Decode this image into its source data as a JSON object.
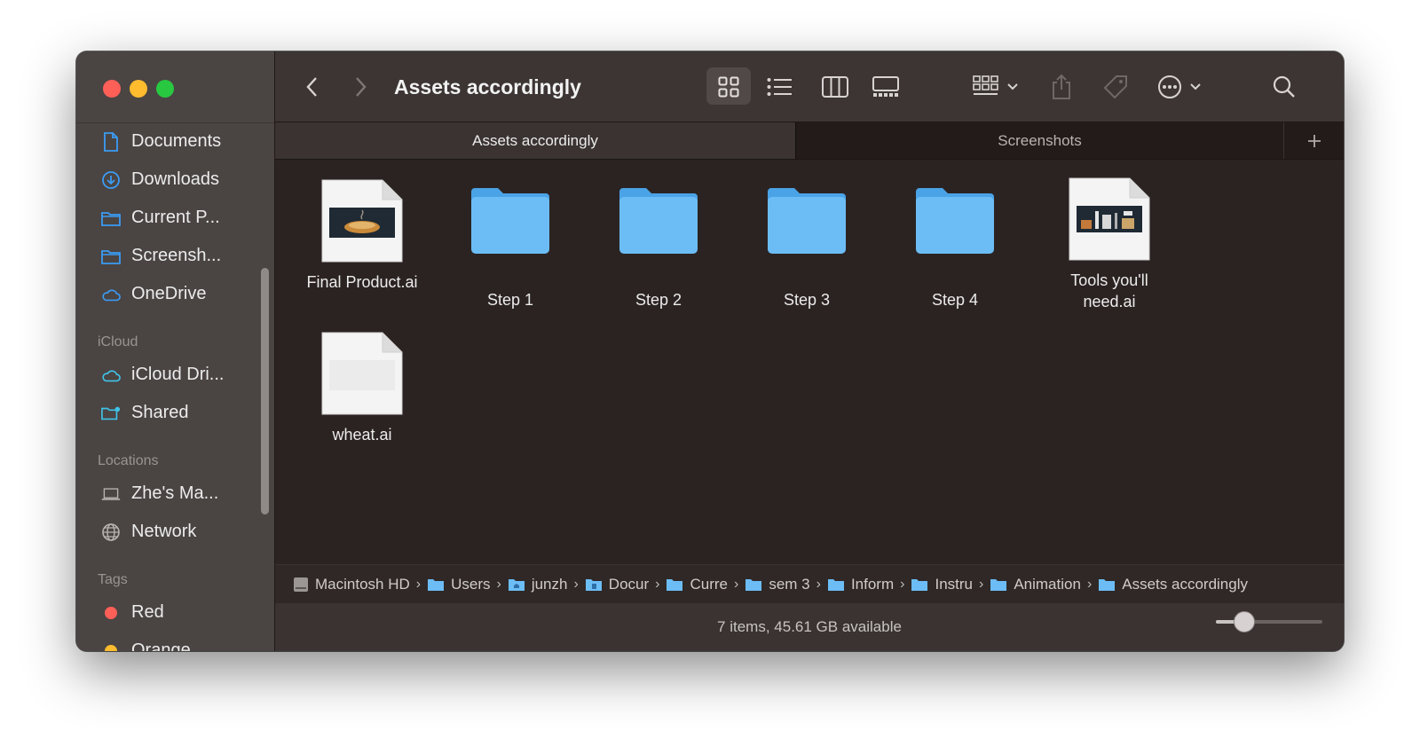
{
  "window": {
    "title": "Assets accordingly"
  },
  "sidebar": {
    "favorites": [
      {
        "label": "Documents",
        "icon": "document-icon"
      },
      {
        "label": "Downloads",
        "icon": "download-icon"
      },
      {
        "label": "Current P...",
        "icon": "folder-icon"
      },
      {
        "label": "Screensh...",
        "icon": "folder-icon"
      },
      {
        "label": "OneDrive",
        "icon": "cloud-icon"
      }
    ],
    "icloud_heading": "iCloud",
    "icloud": [
      {
        "label": "iCloud Dri...",
        "icon": "cloud-icon"
      },
      {
        "label": "Shared",
        "icon": "shared-folder-icon"
      }
    ],
    "locations_heading": "Locations",
    "locations": [
      {
        "label": "Zhe's Ma...",
        "icon": "laptop-icon"
      },
      {
        "label": "Network",
        "icon": "globe-icon"
      }
    ],
    "tags_heading": "Tags",
    "tags": [
      {
        "label": "Red",
        "color": "#fe5f57"
      },
      {
        "label": "Orange",
        "color": "#febc2e"
      }
    ]
  },
  "tabs": [
    {
      "label": "Assets accordingly",
      "active": true
    },
    {
      "label": "Screenshots",
      "active": false
    }
  ],
  "files": [
    {
      "name": "Final Product.ai",
      "kind": "ai-document"
    },
    {
      "name": "Step 1",
      "kind": "folder"
    },
    {
      "name": "Step 2",
      "kind": "folder"
    },
    {
      "name": "Step 3",
      "kind": "folder"
    },
    {
      "name": "Step 4",
      "kind": "folder"
    },
    {
      "name": "Tools you'll need.ai",
      "kind": "ai-document"
    },
    {
      "name": "wheat.ai",
      "kind": "ai-document"
    }
  ],
  "path": [
    "Macintosh HD",
    "Users",
    "junzh",
    "Docur",
    "Curre",
    "sem 3",
    "Inform",
    "Instru",
    "Animation",
    "Assets accordingly"
  ],
  "status": {
    "text": "7 items, 45.61 GB available"
  },
  "icon_size_slider": {
    "value": 0.27
  },
  "colors": {
    "folder": "#6cbdf6",
    "accent": "#3b9cf5"
  }
}
